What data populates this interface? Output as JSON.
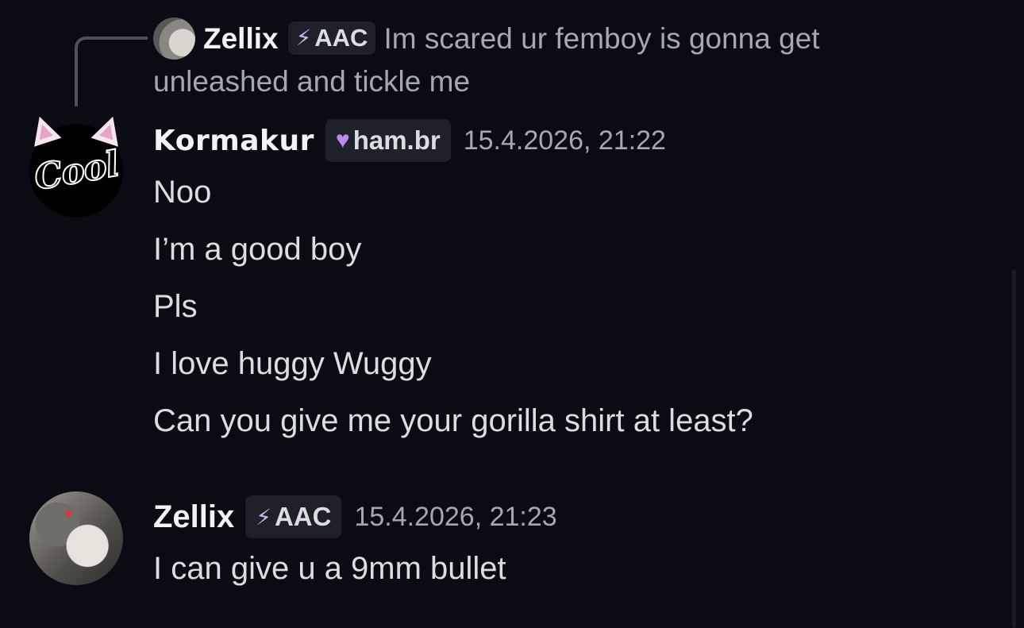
{
  "reply": {
    "author": "Zellix",
    "tag_label": "AAC",
    "tag_icon": "lightning-icon",
    "text": "Im scared ur femboy is gonna get unleashed and tickle me"
  },
  "messages": [
    {
      "author": "Kormakur",
      "avatar_text": "Cool",
      "tag_label": "ham.br",
      "tag_icon": "purple-heart-icon",
      "timestamp": "15.4.2026, 21:22",
      "lines": [
        "Noo",
        "I’m a good boy",
        "Pls",
        "I love huggy Wuggy",
        "Can you give me your gorilla shirt at least?"
      ]
    },
    {
      "author": "Zellix",
      "tag_label": "AAC",
      "tag_icon": "lightning-icon",
      "timestamp": "15.4.2026, 21:23",
      "lines": [
        "I can give u a 9mm bullet"
      ]
    }
  ],
  "colors": {
    "background": "#0b0b14",
    "username": "#f2f3f5",
    "message_text": "#dbdee1",
    "muted_text": "#a6a8b0",
    "tag_background": "#1f2029",
    "tag_accent": "#b48cf0"
  }
}
